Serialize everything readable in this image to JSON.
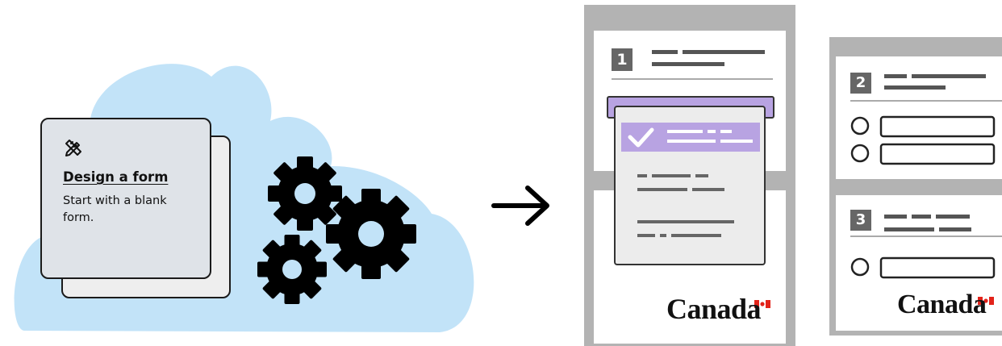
{
  "card": {
    "icon": "pencil-ruler-icon",
    "title": "Design a form",
    "description": "Start with a blank form."
  },
  "pages": {
    "page1": {
      "step": "1",
      "wordmark": "Canada"
    },
    "page2": {
      "step": "2",
      "wordmark": "Canada"
    },
    "page3": {
      "step": "3"
    }
  },
  "icons": [
    "cloud-shape",
    "gear-icon",
    "arrow-right-icon",
    "checkmark-icon",
    "radio-button-icon",
    "canada-flag-icon"
  ],
  "colors": {
    "cloud": "#c2e3f8",
    "card_front": "#dfe3e8",
    "card_back": "#eeeeee",
    "frame_gray": "#b3b3b3",
    "number_box": "#666666",
    "highlight_purple": "#b8a3e2",
    "highlight_purple_dark": "#a38ad6",
    "ink": "#1b1b1b",
    "flag_red": "#e2231a"
  }
}
